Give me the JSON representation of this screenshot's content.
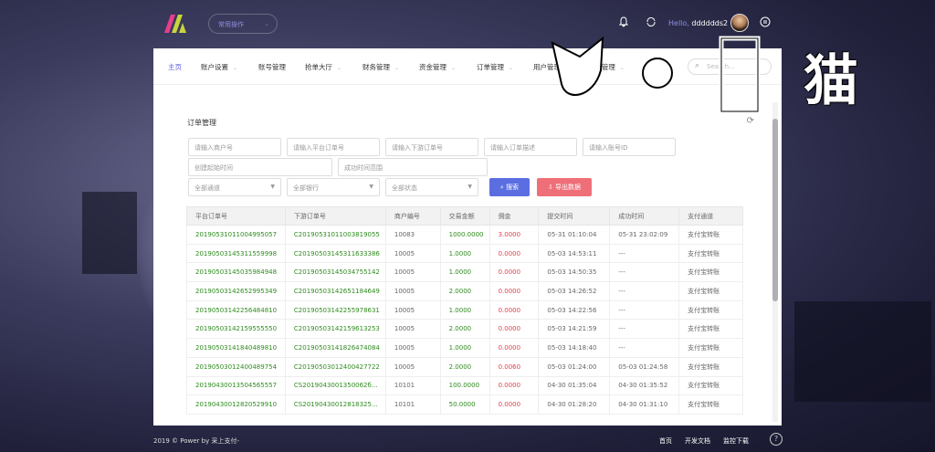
{
  "header": {
    "common_ops": "常用操作",
    "hello_prefix": "Hello,",
    "username": "dddddds2"
  },
  "nav": {
    "items": [
      "主页",
      "账户设置",
      "账号管理",
      "抢单大厅",
      "财务管理",
      "资金管理",
      "订单管理",
      "用户管理",
      "API管理"
    ],
    "search_placeholder": "Search..."
  },
  "panel": {
    "title": "订单管理",
    "filters": {
      "merchant_no": "请输入商户号",
      "platform_order": "请输入平台订单号",
      "downstream_order": "请输入下游订单号",
      "order_desc": "请输入订单描述",
      "account_id": "请输入账号ID",
      "created_time": "创建起始时间",
      "success_time": "成功时间范围",
      "channel": "全部通道",
      "bank": "全部银行",
      "status": "全部状态"
    },
    "search_button": "搜索",
    "export_button": "导出数据"
  },
  "table": {
    "headers": [
      "平台订单号",
      "下游订单号",
      "商户编号",
      "交易金额",
      "佣金",
      "提交时间",
      "成功时间",
      "支付通道"
    ],
    "rows": [
      [
        "20190531011004995057",
        "C20190531011003819055",
        "10083",
        "1000.0000",
        "3.0000",
        "05-31 01:10:04",
        "05-31 23:02:09",
        "支付宝转账"
      ],
      [
        "20190503145311559998",
        "C20190503145311633386",
        "10005",
        "1.0000",
        "0.0000",
        "05-03 14:53:11",
        "---",
        "支付宝转账"
      ],
      [
        "20190503145035984948",
        "C20190503145034755142",
        "10005",
        "1.0000",
        "0.0000",
        "05-03 14:50:35",
        "---",
        "支付宝转账"
      ],
      [
        "20190503142652995349",
        "C20190503142651184649",
        "10005",
        "2.0000",
        "0.0000",
        "05-03 14:26:52",
        "---",
        "支付宝转账"
      ],
      [
        "20190503142256484810",
        "C20190503142255978631",
        "10005",
        "1.0000",
        "0.0000",
        "05-03 14:22:56",
        "---",
        "支付宝转账"
      ],
      [
        "20190503142159555550",
        "C20190503142159613253",
        "10005",
        "2.0000",
        "0.0000",
        "05-03 14:21:59",
        "---",
        "支付宝转账"
      ],
      [
        "20190503141840489810",
        "C20190503141826474084",
        "10005",
        "1.0000",
        "0.0000",
        "05-03 14:18:40",
        "---",
        "支付宝转账"
      ],
      [
        "20190503012400489754",
        "C20190503012400427722",
        "10005",
        "2.0000",
        "0.0060",
        "05-03 01:24:00",
        "05-03 01:24:58",
        "支付宝转账"
      ],
      [
        "20190430013504565557",
        "CS2019043001350062б...",
        "10101",
        "100.0000",
        "0.0000",
        "04-30 01:35:04",
        "04-30 01:35:52",
        "支付宝转账"
      ],
      [
        "20190430012820529910",
        "CS20190430012818325...",
        "10101",
        "50.0000",
        "0.0000",
        "04-30 01:28:20",
        "04-30 01:31:10",
        "支付宝转账"
      ]
    ]
  },
  "watermark": {
    "text": "猫"
  },
  "footer": {
    "copyright": "2019 © Power by 采上支付-",
    "links": [
      "首页",
      "开发文档",
      "监控下载"
    ]
  }
}
